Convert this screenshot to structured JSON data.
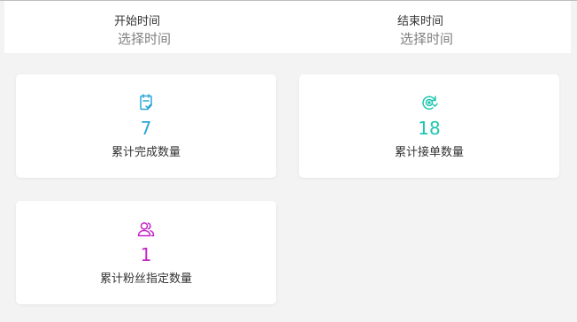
{
  "filters": {
    "start": {
      "label": "开始时间",
      "value": "选择时间"
    },
    "end": {
      "label": "结束时间",
      "value": "选择时间"
    }
  },
  "stats": {
    "completed": {
      "count": "7",
      "title": "累计完成数量",
      "icon": "clipboard-check-icon",
      "color": "#2aa6d8"
    },
    "accepted": {
      "count": "18",
      "title": "累计接单数量",
      "icon": "target-refresh-icon",
      "color": "#1fc7b0"
    },
    "fans": {
      "count": "1",
      "title": "累计粉丝指定数量",
      "icon": "users-icon",
      "color": "#c224c9"
    }
  }
}
